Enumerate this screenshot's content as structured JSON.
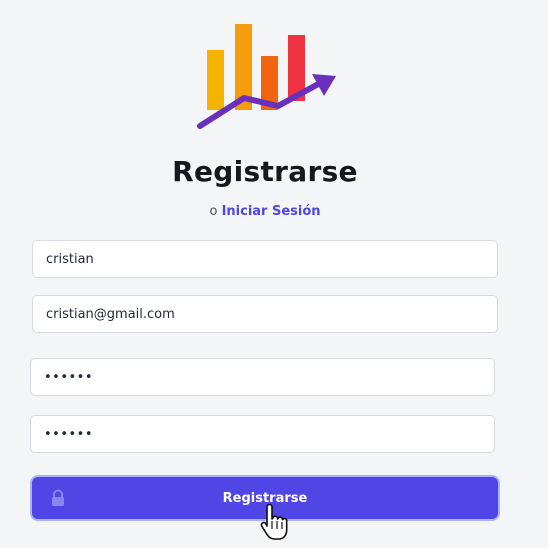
{
  "colors": {
    "accent": "#4f46e5",
    "background": "#f4f5f7",
    "logo_bars": [
      "#f5b400",
      "#f59c0b",
      "#f2650f",
      "#ef3340"
    ],
    "logo_arrow": "#6b2fbd"
  },
  "icons": {
    "logo": "rising-bar-chart-logo",
    "button_icon": "lock-icon",
    "cursor": "hand-pointer-cursor"
  },
  "form": {
    "title": "Registrarse",
    "alt_prefix": "o",
    "alt_link": "Iniciar Sesión",
    "name_value": "cristian",
    "email_value": "cristian@gmail.com",
    "password_value": "••••••",
    "confirm_password_value": "••••••",
    "submit_label": "Registrarse"
  }
}
